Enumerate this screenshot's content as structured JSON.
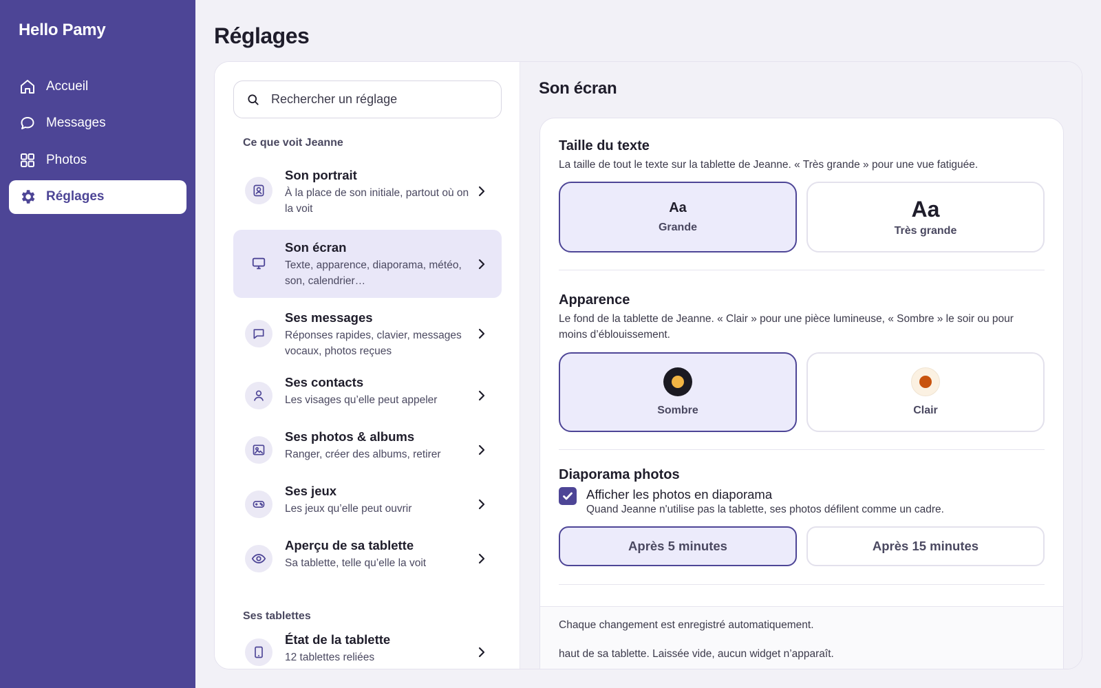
{
  "app": {
    "brand": "Hello Pamy"
  },
  "nav": [
    {
      "label": "Accueil",
      "icon": "home-icon"
    },
    {
      "label": "Messages",
      "icon": "chat-bubble-icon"
    },
    {
      "label": "Photos",
      "icon": "grid-icon"
    },
    {
      "label": "Réglages",
      "icon": "gear-icon",
      "active": true
    }
  ],
  "page": {
    "title": "Réglages"
  },
  "search": {
    "placeholder": "Rechercher un réglage"
  },
  "left": {
    "section1_label": "Ce que voit Jeanne",
    "section2_label": "Ses tablettes",
    "items": [
      {
        "title": "Son portrait",
        "desc": "À la place de son initiale, partout où on la voit",
        "icon": "portrait-icon"
      },
      {
        "title": "Son écran",
        "desc": "Texte, apparence, diaporama, météo, son, calendrier…",
        "icon": "monitor-icon",
        "selected": true
      },
      {
        "title": "Ses messages",
        "desc": "Réponses rapides, clavier, messages vocaux, photos reçues",
        "icon": "message-icon"
      },
      {
        "title": "Ses contacts",
        "desc": "Les visages qu’elle peut appeler",
        "icon": "person-icon"
      },
      {
        "title": "Ses photos & albums",
        "desc": "Ranger, créer des albums, retirer",
        "icon": "image-icon"
      },
      {
        "title": "Ses jeux",
        "desc": "Les jeux qu’elle peut ouvrir",
        "icon": "gamepad-icon"
      },
      {
        "title": "Aperçu de sa tablette",
        "desc": "Sa tablette, telle qu’elle la voit",
        "icon": "eye-icon"
      },
      {
        "title": "État de la tablette",
        "desc": "12 tablettes reliées",
        "icon": "tablet-icon"
      }
    ]
  },
  "right": {
    "title": "Son écran",
    "text_size": {
      "title": "Taille du texte",
      "desc": "La taille de tout le texte sur la tablette de Jeanne. « Très grande » pour une vue fatiguée.",
      "options": [
        {
          "sample": "Aa",
          "label": "Grande",
          "selected": true
        },
        {
          "sample": "Aa",
          "label": "Très grande"
        }
      ]
    },
    "appearance": {
      "title": "Apparence",
      "desc": "Le fond de la tablette de Jeanne. « Clair » pour une pièce lumineuse, « Sombre » le soir ou pour moins d’éblouissement.",
      "options": [
        {
          "label": "Sombre",
          "selected": true
        },
        {
          "label": "Clair"
        }
      ]
    },
    "slideshow": {
      "title": "Diaporama photos",
      "checkbox_label": "Afficher les photos en diaporama",
      "checkbox_checked": true,
      "checkbox_desc": "Quand Jeanne n'utilise pas la tablette, ses photos défilent comme un cadre.",
      "options": [
        {
          "label": "Après 5 minutes",
          "selected": true
        },
        {
          "label": "Après 15 minutes"
        }
      ]
    },
    "footer": {
      "autosave": "Chaque changement est enregistré automatiquement.",
      "widget_note": "haut de sa tablette. Laissée vide, aucun widget n’apparaît."
    }
  },
  "colors": {
    "sidebar": "#4d4596",
    "accent": "#4d4596",
    "selected_bg": "#ecebfb"
  }
}
